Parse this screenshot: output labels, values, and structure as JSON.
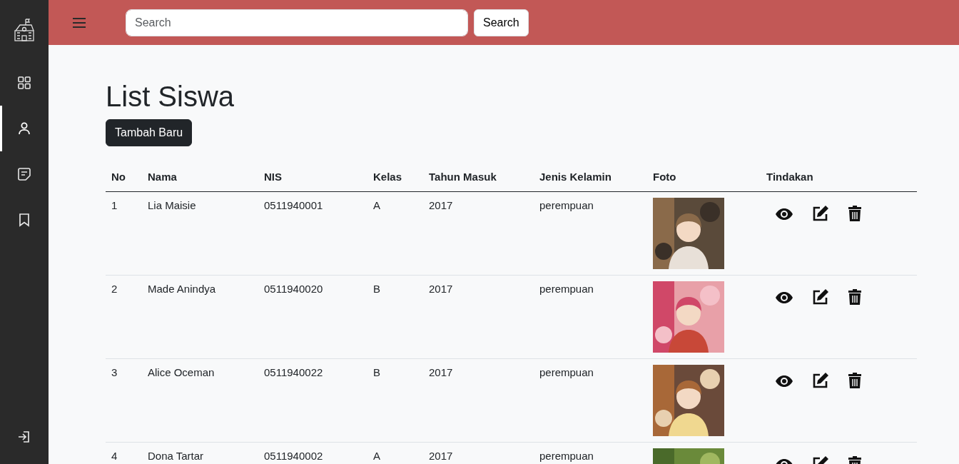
{
  "sidebar": {
    "items": [
      {
        "kind": "grid",
        "selected": false
      },
      {
        "kind": "person",
        "selected": true
      },
      {
        "kind": "note",
        "selected": false
      },
      {
        "kind": "bookmark",
        "selected": false
      }
    ]
  },
  "header": {
    "search": {
      "placeholder": "Search"
    },
    "search_button": "Search"
  },
  "page_title": "List Siswa",
  "add_button": "Tambah Baru",
  "table": {
    "columns": [
      "No",
      "Nama",
      "NIS",
      "Kelas",
      "Tahun Masuk",
      "Jenis Kelamin",
      "Foto",
      "Tindakan"
    ],
    "rows": [
      {
        "cells": [
          "1",
          "Lia Maisie",
          "0511940001",
          "A",
          "2017",
          "perempuan"
        ]
      },
      {
        "cells": [
          "2",
          "Made Anindya",
          "0511940020",
          "B",
          "2017",
          "perempuan"
        ]
      },
      {
        "cells": [
          "3",
          "Alice Oceman",
          "0511940022",
          "B",
          "2017",
          "perempuan"
        ]
      },
      {
        "cells": [
          "4",
          "Dona Tartar",
          "0511940002",
          "A",
          "2017",
          "perempuan"
        ]
      }
    ]
  }
}
